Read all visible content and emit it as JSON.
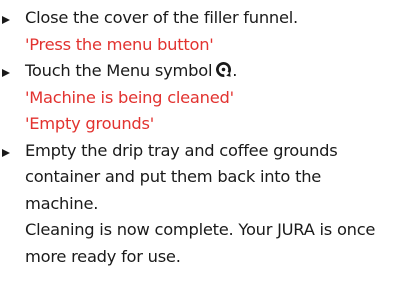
{
  "steps": [
    {
      "lines": [
        {
          "text": "Close the cover of the filler funnel."
        },
        {
          "text": "'Press the menu button'",
          "color": "#e2322f"
        }
      ]
    },
    {
      "lines": [
        {
          "text": "Touch the Menu symbol",
          "icon": "menu-symbol-icon"
        },
        {
          "text": "'Machine is being cleaned'",
          "color": "#e2322f"
        },
        {
          "text": "'Empty grounds'",
          "color": "#e2322f"
        }
      ]
    },
    {
      "lines": [
        {
          "text": "Empty the drip tray and coffee grounds"
        },
        {
          "text": "container and put them back into the"
        },
        {
          "text": "machine."
        },
        {
          "text": "Cleaning is now complete. Your JURA is once"
        },
        {
          "text": "more ready for use."
        }
      ]
    }
  ],
  "icon_suffix": ".",
  "colors": {
    "text": "#1a1a1a",
    "display_message": "#e2322f"
  }
}
